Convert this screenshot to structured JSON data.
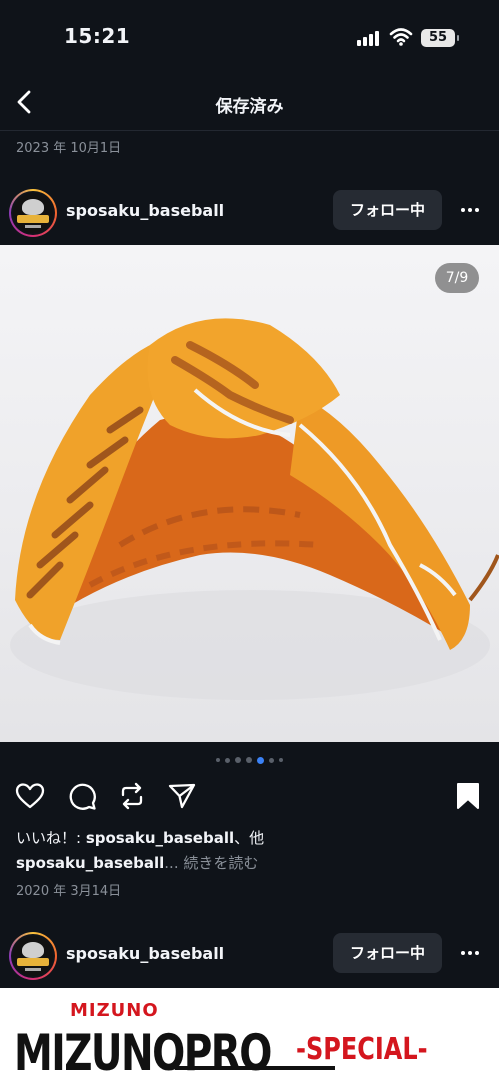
{
  "status_bar": {
    "time": "15:21",
    "battery": "55"
  },
  "header": {
    "title": "保存済み"
  },
  "feed": {
    "top_date": "2023 年 10月1日",
    "post1": {
      "username": "sposaku_baseball",
      "follow_label": "フォロー中",
      "image_counter": "7/9",
      "likes_prefix": "いいね！: ",
      "likes_user": "sposaku_baseball",
      "likes_suffix": "、他",
      "caption_user": "sposaku_baseball",
      "caption_more": "... 続きを読む",
      "date": "2020 年 3月14日"
    },
    "post2": {
      "username": "sposaku_baseball",
      "follow_label": "フォロー中",
      "image_text_brand": "MIZUNO",
      "image_text_title": "MIZUNOPRO",
      "image_text_special": "-SPECIAL-"
    }
  },
  "icons": {
    "back": "chevron-left-icon",
    "like": "heart-icon",
    "comment": "comment-bubble-icon",
    "repost": "repost-icon",
    "share": "send-icon",
    "save": "bookmark-icon",
    "more": "more-dots-icon"
  },
  "colors": {
    "background": "#0f1319",
    "accent_red": "#d4161e",
    "glove_orange": "#e98a24"
  }
}
